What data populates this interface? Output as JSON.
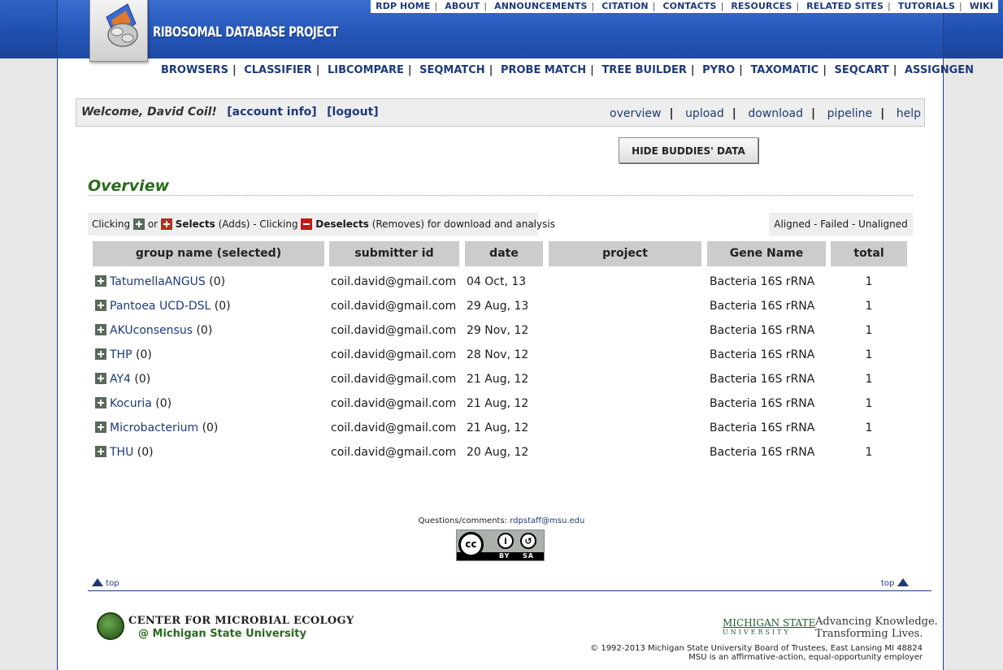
{
  "top_links": [
    "RDP HOME",
    "ABOUT",
    "ANNOUNCEMENTS",
    "CITATION",
    "CONTACTS",
    "RESOURCES",
    "RELATED SITES",
    "TUTORIALS",
    "WIKI"
  ],
  "site_title": "RIBOSOMAL DATABASE PROJECT",
  "main_nav": [
    "BROWSERS",
    "CLASSIFIER",
    "LIBCOMPARE",
    "SEQMATCH",
    "PROBE MATCH",
    "TREE BUILDER",
    "PYRO",
    "TAXOMATIC",
    "SEQCART",
    "ASSIGNGEN"
  ],
  "welcome": {
    "greeting": "Welcome, David Coil!",
    "account_info": "[account info]",
    "logout": "[logout]"
  },
  "sub_nav": [
    "overview",
    "upload",
    "download",
    "pipeline",
    "help"
  ],
  "hide_button": "HIDE BUDDIES' DATA",
  "section_title": "Overview",
  "legend": {
    "clicking": "Clicking",
    "or": "or",
    "selects": "Selects",
    "adds": "(Adds) - Clicking",
    "deselects": "Deselects",
    "removes": "(Removes) for download and analysis",
    "status": "Aligned - Failed - Unaligned"
  },
  "table": {
    "headers": [
      "group name (selected)",
      "submitter id",
      "date",
      "project",
      "Gene Name",
      "total"
    ],
    "rows": [
      {
        "name": "TatumellaANGUS",
        "count": "(0)",
        "submitter": "coil.david@gmail.com",
        "date": "04 Oct, 13",
        "project": "",
        "gene": "Bacteria 16S rRNA",
        "total": "1"
      },
      {
        "name": "Pantoea UCD-DSL",
        "count": "(0)",
        "submitter": "coil.david@gmail.com",
        "date": "29 Aug, 13",
        "project": "",
        "gene": "Bacteria 16S rRNA",
        "total": "1"
      },
      {
        "name": "AKUconsensus",
        "count": "(0)",
        "submitter": "coil.david@gmail.com",
        "date": "29 Nov, 12",
        "project": "",
        "gene": "Bacteria 16S rRNA",
        "total": "1"
      },
      {
        "name": "THP",
        "count": "(0)",
        "submitter": "coil.david@gmail.com",
        "date": "28 Nov, 12",
        "project": "",
        "gene": "Bacteria 16S rRNA",
        "total": "1"
      },
      {
        "name": "AY4",
        "count": "(0)",
        "submitter": "coil.david@gmail.com",
        "date": "21 Aug, 12",
        "project": "",
        "gene": "Bacteria 16S rRNA",
        "total": "1"
      },
      {
        "name": "Kocuria",
        "count": "(0)",
        "submitter": "coil.david@gmail.com",
        "date": "21 Aug, 12",
        "project": "",
        "gene": "Bacteria 16S rRNA",
        "total": "1"
      },
      {
        "name": "Microbacterium",
        "count": "(0)",
        "submitter": "coil.david@gmail.com",
        "date": "21 Aug, 12",
        "project": "",
        "gene": "Bacteria 16S rRNA",
        "total": "1"
      },
      {
        "name": "THU",
        "count": "(0)",
        "submitter": "coil.david@gmail.com",
        "date": "20 Aug, 12",
        "project": "",
        "gene": "Bacteria 16S rRNA",
        "total": "1"
      }
    ]
  },
  "footer": {
    "questions": "Questions/comments:",
    "email": "rdpstaff@msu.edu",
    "cc_labels": [
      "BY",
      "SA"
    ],
    "top_left": "top",
    "top_right": "top",
    "cme_line1": "CENTER FOR MICROBIAL ECOLOGY",
    "cme_line2": "@ Michigan State University",
    "msu_name": "MICHIGAN STATE",
    "msu_sub": "UNIVERSITY",
    "msu_tag1": "Advancing Knowledge.",
    "msu_tag2": "Transforming Lives.",
    "copyright1": "© 1992-2013 Michigan State University Board of Trustees, East Lansing MI 48824",
    "copyright2": "MSU is an affirmative-action, equal-opportunity employer"
  },
  "colors": {
    "header_blue": "#2456b8",
    "link_navy": "#1d3a7a",
    "title_green": "#2a6a1e"
  }
}
